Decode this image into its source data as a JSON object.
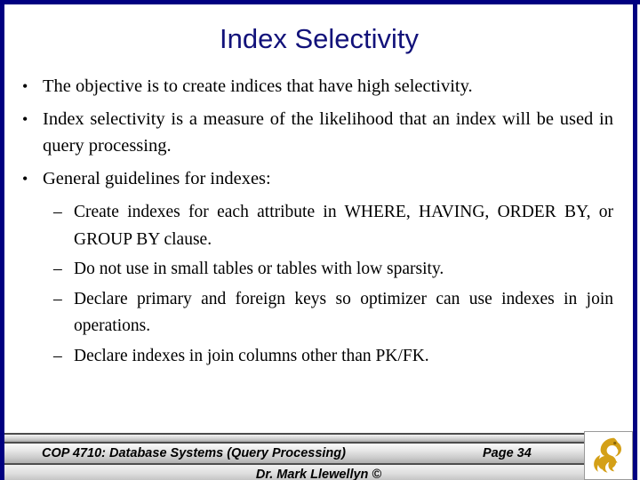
{
  "slide": {
    "title": "Index Selectivity",
    "title_color": "#12127a",
    "border_color": "#000080",
    "background": "#ffffff"
  },
  "content": {
    "bullet_marker": "•",
    "sub_marker": "–",
    "bullets": [
      {
        "text": "The objective is to create indices that have high selectivity.",
        "sub": []
      },
      {
        "text": "Index selectivity is a measure of the likelihood that an index will be used in query processing.",
        "sub": []
      },
      {
        "text": "General guidelines for indexes:",
        "sub": [
          "Create indexes for each attribute in WHERE, HAVING, ORDER BY, or GROUP BY clause.",
          "Do not use in small tables or tables with low sparsity.",
          "Declare primary and foreign keys so optimizer can use indexes in join operations.",
          "Declare indexes in join columns other than PK/FK."
        ]
      }
    ]
  },
  "footer": {
    "course": "COP 4710: Database Systems (Query Processing)",
    "page": "Page 34",
    "author": "Dr. Mark Llewellyn ©",
    "logo_name": "ucf-pegasus-logo",
    "logo_color": "#d4a017"
  }
}
